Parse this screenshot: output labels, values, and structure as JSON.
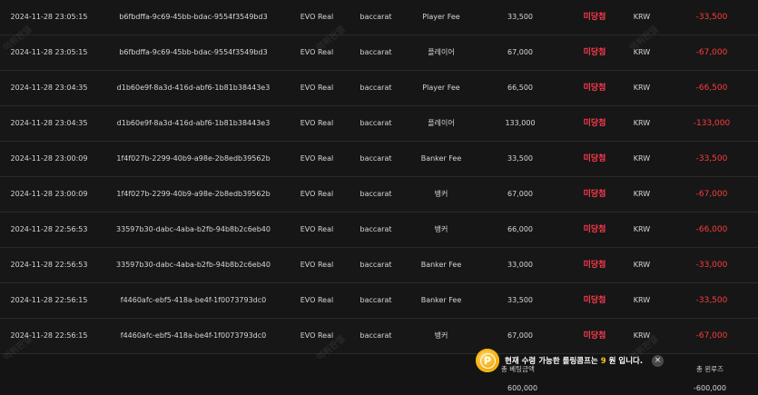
{
  "rows": [
    {
      "date": "2024-11-28 23:05:15",
      "id": "b6fbdffa-9c69-45bb-bdac-9554f3549bd3",
      "vendor": "EVO Real",
      "game": "baccarat",
      "bet": "Player Fee",
      "amount": "33,500",
      "status": "미당첨",
      "currency": "KRW",
      "total": "-33,500"
    },
    {
      "date": "2024-11-28 23:05:15",
      "id": "b6fbdffa-9c69-45bb-bdac-9554f3549bd3",
      "vendor": "EVO Real",
      "game": "baccarat",
      "bet": "플레이어",
      "amount": "67,000",
      "status": "미당첨",
      "currency": "KRW",
      "total": "-67,000"
    },
    {
      "date": "2024-11-28 23:04:35",
      "id": "d1b60e9f-8a3d-416d-abf6-1b81b38443e3",
      "vendor": "EVO Real",
      "game": "baccarat",
      "bet": "Player Fee",
      "amount": "66,500",
      "status": "미당첨",
      "currency": "KRW",
      "total": "-66,500"
    },
    {
      "date": "2024-11-28 23:04:35",
      "id": "d1b60e9f-8a3d-416d-abf6-1b81b38443e3",
      "vendor": "EVO Real",
      "game": "baccarat",
      "bet": "플레이어",
      "amount": "133,000",
      "status": "미당첨",
      "currency": "KRW",
      "total": "-133,000"
    },
    {
      "date": "2024-11-28 23:00:09",
      "id": "1f4f027b-2299-40b9-a98e-2b8edb39562b",
      "vendor": "EVO Real",
      "game": "baccarat",
      "bet": "Banker Fee",
      "amount": "33,500",
      "status": "미당첨",
      "currency": "KRW",
      "total": "-33,500"
    },
    {
      "date": "2024-11-28 23:00:09",
      "id": "1f4f027b-2299-40b9-a98e-2b8edb39562b",
      "vendor": "EVO Real",
      "game": "baccarat",
      "bet": "뱅커",
      "amount": "67,000",
      "status": "미당첨",
      "currency": "KRW",
      "total": "-67,000"
    },
    {
      "date": "2024-11-28 22:56:53",
      "id": "33597b30-dabc-4aba-b2fb-94b8b2c6eb40",
      "vendor": "EVO Real",
      "game": "baccarat",
      "bet": "뱅커",
      "amount": "66,000",
      "status": "미당첨",
      "currency": "KRW",
      "total": "-66,000"
    },
    {
      "date": "2024-11-28 22:56:53",
      "id": "33597b30-dabc-4aba-b2fb-94b8b2c6eb40",
      "vendor": "EVO Real",
      "game": "baccarat",
      "bet": "Banker Fee",
      "amount": "33,000",
      "status": "미당첨",
      "currency": "KRW",
      "total": "-33,000"
    },
    {
      "date": "2024-11-28 22:56:15",
      "id": "f4460afc-ebf5-418a-be4f-1f0073793dc0",
      "vendor": "EVO Real",
      "game": "baccarat",
      "bet": "Banker Fee",
      "amount": "33,500",
      "status": "미당첨",
      "currency": "KRW",
      "total": "-33,500"
    },
    {
      "date": "2024-11-28 22:56:15",
      "id": "f4460afc-ebf5-418a-be4f-1f0073793dc0",
      "vendor": "EVO Real",
      "game": "baccarat",
      "bet": "뱅커",
      "amount": "67,000",
      "status": "미당첨",
      "currency": "KRW",
      "total": "-67,000"
    }
  ],
  "summary": {
    "bet_label": "총 베팅금액",
    "bet_value": "600,000",
    "total_label": "총 윈루즈",
    "total_value": "-600,000"
  },
  "toast": {
    "text_before": "현재 수령 가능한 롤링콤프는",
    "number": "9",
    "text_after": "원 입니다.",
    "close": "×",
    "coin_letter": "P"
  },
  "watermark": "먹튀판엘",
  "colors": {
    "background": "#141414",
    "loss_red": "#ff3b3b",
    "coin_gold": "#f0a500",
    "highlight_yellow": "#ffc21a"
  }
}
